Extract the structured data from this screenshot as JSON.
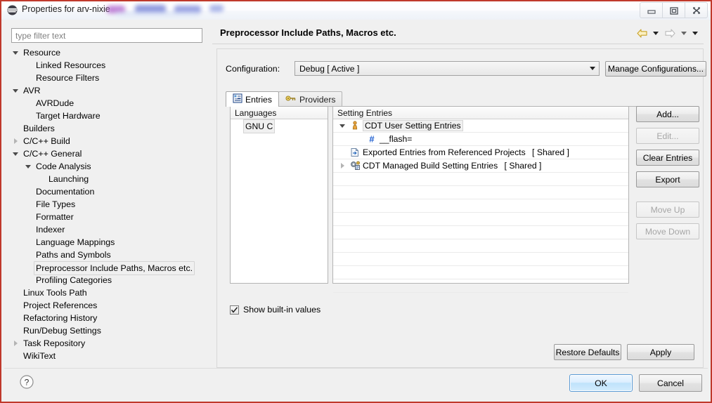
{
  "window": {
    "title": "Properties for arv-nixie",
    "app_icon": "eclipse-icon",
    "controls": [
      {
        "name": "minimize-button",
        "glyph": "minimize-icon"
      },
      {
        "name": "restore-button",
        "glyph": "restore-icon"
      },
      {
        "name": "close-button",
        "glyph": "close-icon"
      }
    ]
  },
  "filter": {
    "placeholder": "type filter text",
    "value": ""
  },
  "tree": {
    "items": [
      {
        "label": "Resource",
        "indent": 0,
        "twisty": "expanded",
        "selected": false
      },
      {
        "label": "Linked Resources",
        "indent": 1,
        "twisty": "none",
        "selected": false
      },
      {
        "label": "Resource Filters",
        "indent": 1,
        "twisty": "none",
        "selected": false
      },
      {
        "label": "AVR",
        "indent": 0,
        "twisty": "expanded",
        "selected": false
      },
      {
        "label": "AVRDude",
        "indent": 1,
        "twisty": "none",
        "selected": false
      },
      {
        "label": "Target Hardware",
        "indent": 1,
        "twisty": "none",
        "selected": false
      },
      {
        "label": "Builders",
        "indent": 0,
        "twisty": "none",
        "selected": false
      },
      {
        "label": "C/C++ Build",
        "indent": 0,
        "twisty": "collapsed",
        "selected": false
      },
      {
        "label": "C/C++ General",
        "indent": 0,
        "twisty": "expanded",
        "selected": false
      },
      {
        "label": "Code Analysis",
        "indent": 1,
        "twisty": "expanded",
        "selected": false
      },
      {
        "label": "Launching",
        "indent": 2,
        "twisty": "none",
        "selected": false
      },
      {
        "label": "Documentation",
        "indent": 1,
        "twisty": "none",
        "selected": false
      },
      {
        "label": "File Types",
        "indent": 1,
        "twisty": "none",
        "selected": false
      },
      {
        "label": "Formatter",
        "indent": 1,
        "twisty": "none",
        "selected": false
      },
      {
        "label": "Indexer",
        "indent": 1,
        "twisty": "none",
        "selected": false
      },
      {
        "label": "Language Mappings",
        "indent": 1,
        "twisty": "none",
        "selected": false
      },
      {
        "label": "Paths and Symbols",
        "indent": 1,
        "twisty": "none",
        "selected": false
      },
      {
        "label": "Preprocessor Include Paths, Macros etc.",
        "indent": 1,
        "twisty": "none",
        "selected": true
      },
      {
        "label": "Profiling Categories",
        "indent": 1,
        "twisty": "none",
        "selected": false
      },
      {
        "label": "Linux Tools Path",
        "indent": 0,
        "twisty": "none",
        "selected": false
      },
      {
        "label": "Project References",
        "indent": 0,
        "twisty": "none",
        "selected": false
      },
      {
        "label": "Refactoring History",
        "indent": 0,
        "twisty": "none",
        "selected": false
      },
      {
        "label": "Run/Debug Settings",
        "indent": 0,
        "twisty": "none",
        "selected": false
      },
      {
        "label": "Task Repository",
        "indent": 0,
        "twisty": "collapsed",
        "selected": false
      },
      {
        "label": "WikiText",
        "indent": 0,
        "twisty": "none",
        "selected": false
      }
    ]
  },
  "page": {
    "title": "Preprocessor Include Paths, Macros etc.",
    "nav": {
      "back_icon": "back-arrow-icon",
      "back_menu_icon": "chevron-down-icon",
      "forward_icon": "forward-arrow-icon",
      "forward_menu_icon": "chevron-down-icon",
      "view_menu_icon": "chevron-down-icon"
    }
  },
  "configuration": {
    "label": "Configuration:",
    "value": "Debug  [ Active ]",
    "manage_button": "Manage Configurations..."
  },
  "tabs": [
    {
      "label": "Entries",
      "icon": "entries-list-icon",
      "active": true
    },
    {
      "label": "Providers",
      "icon": "key-icon",
      "active": false
    }
  ],
  "languages": {
    "header": "Languages",
    "items": [
      {
        "label": "GNU C",
        "selected": true
      }
    ]
  },
  "setting_entries": {
    "header": "Setting Entries",
    "rows": [
      {
        "label": "CDT User Setting Entries",
        "suffix": "",
        "icon": "user-person-icon",
        "twisty": "expanded",
        "indent": 0,
        "selected": true
      },
      {
        "label": "__flash=",
        "suffix": "",
        "icon": "macro-hash-icon",
        "twisty": "none",
        "indent": 1,
        "selected": false
      },
      {
        "label": "Exported Entries from Referenced Projects",
        "suffix": "[ Shared ]",
        "icon": "export-page-icon",
        "twisty": "none",
        "indent": 0,
        "selected": false
      },
      {
        "label": "CDT Managed Build Setting Entries",
        "suffix": "[ Shared ]",
        "icon": "managed-build-icon",
        "twisty": "collapsed",
        "indent": 0,
        "selected": false
      }
    ],
    "empty_row_count": 9
  },
  "side_buttons": [
    {
      "label": "Add...",
      "enabled": true,
      "name": "add-button"
    },
    {
      "label": "Edit...",
      "enabled": false,
      "name": "edit-button"
    },
    {
      "label": "Clear Entries",
      "enabled": true,
      "name": "clear-entries-button"
    },
    {
      "label": "Export",
      "enabled": true,
      "name": "export-button"
    },
    {
      "label": "Move Up",
      "enabled": false,
      "name": "move-up-button"
    },
    {
      "label": "Move Down",
      "enabled": false,
      "name": "move-down-button"
    }
  ],
  "show_builtin": {
    "label": "Show built-in values",
    "checked": true
  },
  "panel_buttons": {
    "restore_defaults": "Restore Defaults",
    "apply": "Apply"
  },
  "footer": {
    "help_icon": "help-question-icon",
    "ok": "OK",
    "cancel": "Cancel"
  },
  "colors": {
    "window_border": "#c0392b",
    "accent_ok": "#5b9bd5",
    "macro_blue": "#1f5fd0",
    "person_orange": "#e8a33d",
    "selection_gray": "#f0f0f0"
  }
}
